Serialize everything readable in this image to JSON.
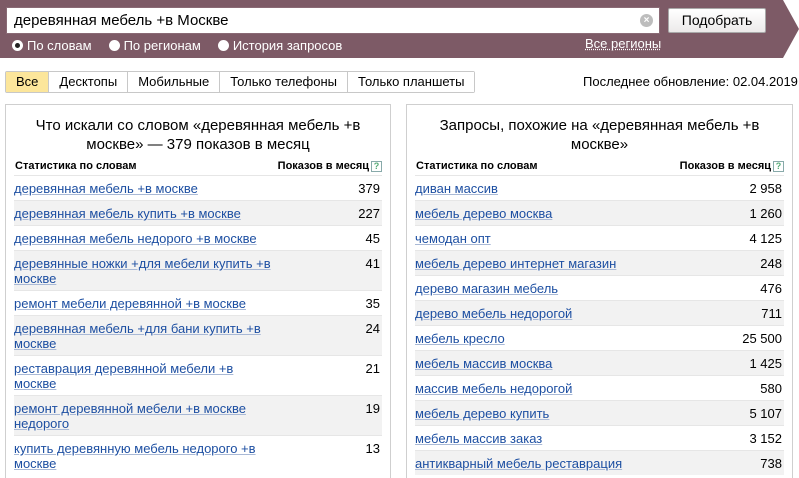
{
  "search": {
    "value": "деревянная мебель +в Москве",
    "submit_label": "Подобрать",
    "clear_icon": "×",
    "modes": [
      {
        "label": "По словам",
        "checked": true
      },
      {
        "label": "По регионам",
        "checked": false
      },
      {
        "label": "История запросов",
        "checked": false
      }
    ],
    "regions_link": "Все регионы"
  },
  "tabs": [
    {
      "label": "Все",
      "active": true
    },
    {
      "label": "Десктопы",
      "active": false
    },
    {
      "label": "Мобильные",
      "active": false
    },
    {
      "label": "Только телефоны",
      "active": false
    },
    {
      "label": "Только планшеты",
      "active": false
    }
  ],
  "last_updated": "Последнее обновление: 02.04.2019",
  "left_panel": {
    "title": "Что искали со словом «деревянная мебель +в москве» — 379 показов в месяц",
    "col_query": "Статистика по словам",
    "col_count": "Показов в месяц",
    "help_icon": "?",
    "rows": [
      {
        "query": "деревянная мебель +в москве",
        "count": "379"
      },
      {
        "query": "деревянная мебель купить +в москве",
        "count": "227"
      },
      {
        "query": "деревянная мебель недорого +в москве",
        "count": "45"
      },
      {
        "query": "деревянные ножки +для мебели купить +в москве",
        "count": "41"
      },
      {
        "query": "ремонт мебели деревянной +в москве",
        "count": "35"
      },
      {
        "query": "деревянная мебель +для бани купить +в москве",
        "count": "24"
      },
      {
        "query": "реставрация деревянной мебели +в москве",
        "count": "21"
      },
      {
        "query": "ремонт деревянной мебели +в москве недорого",
        "count": "19"
      },
      {
        "query": "купить деревянную мебель недорого +в москве",
        "count": "13"
      }
    ]
  },
  "right_panel": {
    "title": "Запросы, похожие на «деревянная мебель +в москве»",
    "col_query": "Статистика по словам",
    "col_count": "Показов в месяц",
    "help_icon": "?",
    "rows": [
      {
        "query": "диван массив",
        "count": "2 958"
      },
      {
        "query": "мебель дерево москва",
        "count": "1 260"
      },
      {
        "query": "чемодан опт",
        "count": "4 125"
      },
      {
        "query": "мебель дерево интернет магазин",
        "count": "248"
      },
      {
        "query": "дерево магазин мебель",
        "count": "476"
      },
      {
        "query": "дерево мебель недорогой",
        "count": "711"
      },
      {
        "query": "мебель кресло",
        "count": "25 500"
      },
      {
        "query": "мебель массив москва",
        "count": "1 425"
      },
      {
        "query": "массив мебель недорогой",
        "count": "580"
      },
      {
        "query": "мебель дерево купить",
        "count": "5 107"
      },
      {
        "query": "мебель массив заказ",
        "count": "3 152"
      },
      {
        "query": "антикварный мебель реставрация",
        "count": "738"
      }
    ]
  }
}
